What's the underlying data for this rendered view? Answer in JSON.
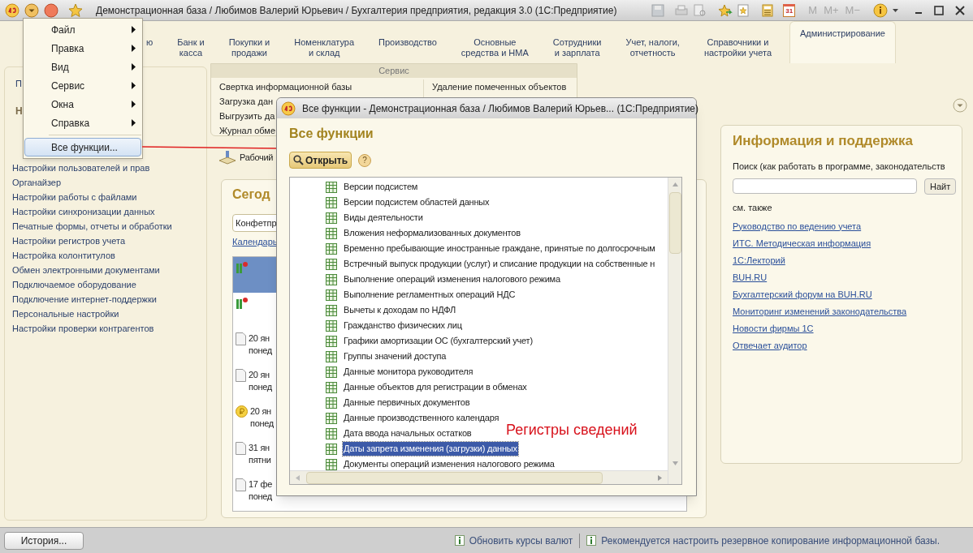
{
  "window": {
    "title": "Демонстрационная база / Любимов Валерий Юрьевич / Бухгалтерия предприятия, редакция 3.0  (1С:Предприятие)"
  },
  "toolbar": {
    "calendar_day": "31",
    "memory_buttons": [
      "M",
      "M+",
      "M−"
    ]
  },
  "sections": [
    {
      "lines": [
        "ю"
      ],
      "selected": false
    },
    {
      "lines": [
        "Банк и",
        "касса"
      ],
      "selected": false
    },
    {
      "lines": [
        "Покупки и",
        "продажи"
      ],
      "selected": false
    },
    {
      "lines": [
        "Номенклатура",
        "и склад"
      ],
      "selected": false
    },
    {
      "lines": [
        "Производство"
      ],
      "selected": false
    },
    {
      "lines": [
        "Основные",
        "средства и НМА"
      ],
      "selected": false
    },
    {
      "lines": [
        "Сотрудники",
        "и зарплата"
      ],
      "selected": false
    },
    {
      "lines": [
        "Учет, налоги,",
        "отчетность"
      ],
      "selected": false
    },
    {
      "lines": [
        "Справочники и",
        "настройки учета"
      ],
      "selected": false
    },
    {
      "lines": [
        "Администрирование"
      ],
      "selected": true
    }
  ],
  "left_panel": {
    "first_link": "П",
    "group_title": "Н",
    "links": [
      "Настройки пользователей и прав",
      "Органайзер",
      "Настройки работы с файлами",
      "Настройки синхронизации данных",
      "Печатные формы, отчеты и обработки",
      "Настройки регистров учета",
      "Настройка колонтитулов",
      "Обмен электронными документами",
      "Подключаемое оборудование",
      "Подключение интернет-поддержки",
      "Персональные настройки",
      "Настройки проверки контрагентов"
    ]
  },
  "service_panel": {
    "title": "Сервис",
    "left": [
      "Свертка информационной базы",
      "Загрузка дан",
      "Выгрузить да",
      "Журнал обме"
    ],
    "right": [
      "Удаление помеченных объектов"
    ]
  },
  "desktop_link": "Рабочий",
  "today_panel": {
    "title": "Сегод",
    "field_value": "Конфетпр",
    "calendar_link": "Календарь",
    "events": [
      {
        "kind": "task",
        "selected": true
      },
      {
        "kind": "task",
        "selected": false
      },
      {
        "kind": "document",
        "date": "20 ян",
        "weekday": "понед",
        "selected": false
      },
      {
        "kind": "document",
        "date": "20 ян",
        "weekday": "понед",
        "selected": false
      },
      {
        "kind": "payment",
        "date": "20 ян",
        "weekday": "понед",
        "selected": false
      },
      {
        "kind": "document",
        "date": "31 ян",
        "weekday": "пятни",
        "selected": false
      },
      {
        "kind": "document",
        "date": "17 фе",
        "weekday": "понед",
        "selected": false
      }
    ]
  },
  "info_panel": {
    "title": "Информация и поддержка",
    "search_label": "Поиск (как работать в программе, законодательств",
    "search_button": "Найт",
    "see_also": "см. также",
    "links": [
      "Руководство по ведению учета",
      "ИТС. Методическая информация",
      "1С:Лекторий",
      "BUH.RU",
      "Бухгалтерский форум на BUH.RU",
      "Мониторинг изменений законодательства",
      "Новости фирмы 1С",
      "Отвечает аудитор"
    ]
  },
  "main_menu": {
    "items": [
      {
        "label": "Файл",
        "submenu": true,
        "separator_before": false,
        "selected": false
      },
      {
        "label": "Правка",
        "submenu": true,
        "separator_before": false,
        "selected": false
      },
      {
        "label": "Вид",
        "submenu": true,
        "separator_before": false,
        "selected": false
      },
      {
        "label": "Сервис",
        "submenu": true,
        "separator_before": false,
        "selected": false
      },
      {
        "label": "Окна",
        "submenu": true,
        "separator_before": false,
        "selected": false
      },
      {
        "label": "Справка",
        "submenu": true,
        "separator_before": false,
        "selected": false
      },
      {
        "label": "Все функции...",
        "submenu": false,
        "separator_before": true,
        "selected": true
      }
    ]
  },
  "dialog": {
    "title": "Все функции - Демонстрационная база / Любимов Валерий Юрьев...  (1С:Предприятие)",
    "heading": "Все функции",
    "open_button": "Открыть",
    "help_button": "?",
    "annotation": "Регистры сведений",
    "items": [
      {
        "label": "Версии подсистем",
        "selected": false
      },
      {
        "label": "Версии подсистем областей данных",
        "selected": false
      },
      {
        "label": "Виды деятельности",
        "selected": false
      },
      {
        "label": "Вложения неформализованных документов",
        "selected": false
      },
      {
        "label": "Временно пребывающие иностранные граждане, принятые по долгосрочным",
        "selected": false
      },
      {
        "label": "Встречный выпуск продукции (услуг) и списание продукции на собственные н",
        "selected": false
      },
      {
        "label": "Выполнение операций изменения налогового режима",
        "selected": false
      },
      {
        "label": "Выполнение регламентных операций НДС",
        "selected": false
      },
      {
        "label": "Вычеты к доходам по НДФЛ",
        "selected": false
      },
      {
        "label": "Гражданство физических лиц",
        "selected": false
      },
      {
        "label": "Графики амортизации ОС (бухгалтерский учет)",
        "selected": false
      },
      {
        "label": "Группы значений доступа",
        "selected": false
      },
      {
        "label": "Данные монитора руководителя",
        "selected": false
      },
      {
        "label": "Данные объектов для регистрации в обменах",
        "selected": false
      },
      {
        "label": "Данные первичных документов",
        "selected": false
      },
      {
        "label": "Данные производственного календаря",
        "selected": false
      },
      {
        "label": "Дата ввода начальных остатков",
        "selected": false
      },
      {
        "label": "Даты запрета изменения (загрузки) данных",
        "selected": true
      },
      {
        "label": "Документы операций изменения налогового режима",
        "selected": false
      }
    ]
  },
  "status_bar": {
    "history_button": "История...",
    "messages": [
      "Обновить курсы валют",
      "Рекомендуется настроить резервное копирование информационной базы."
    ]
  }
}
